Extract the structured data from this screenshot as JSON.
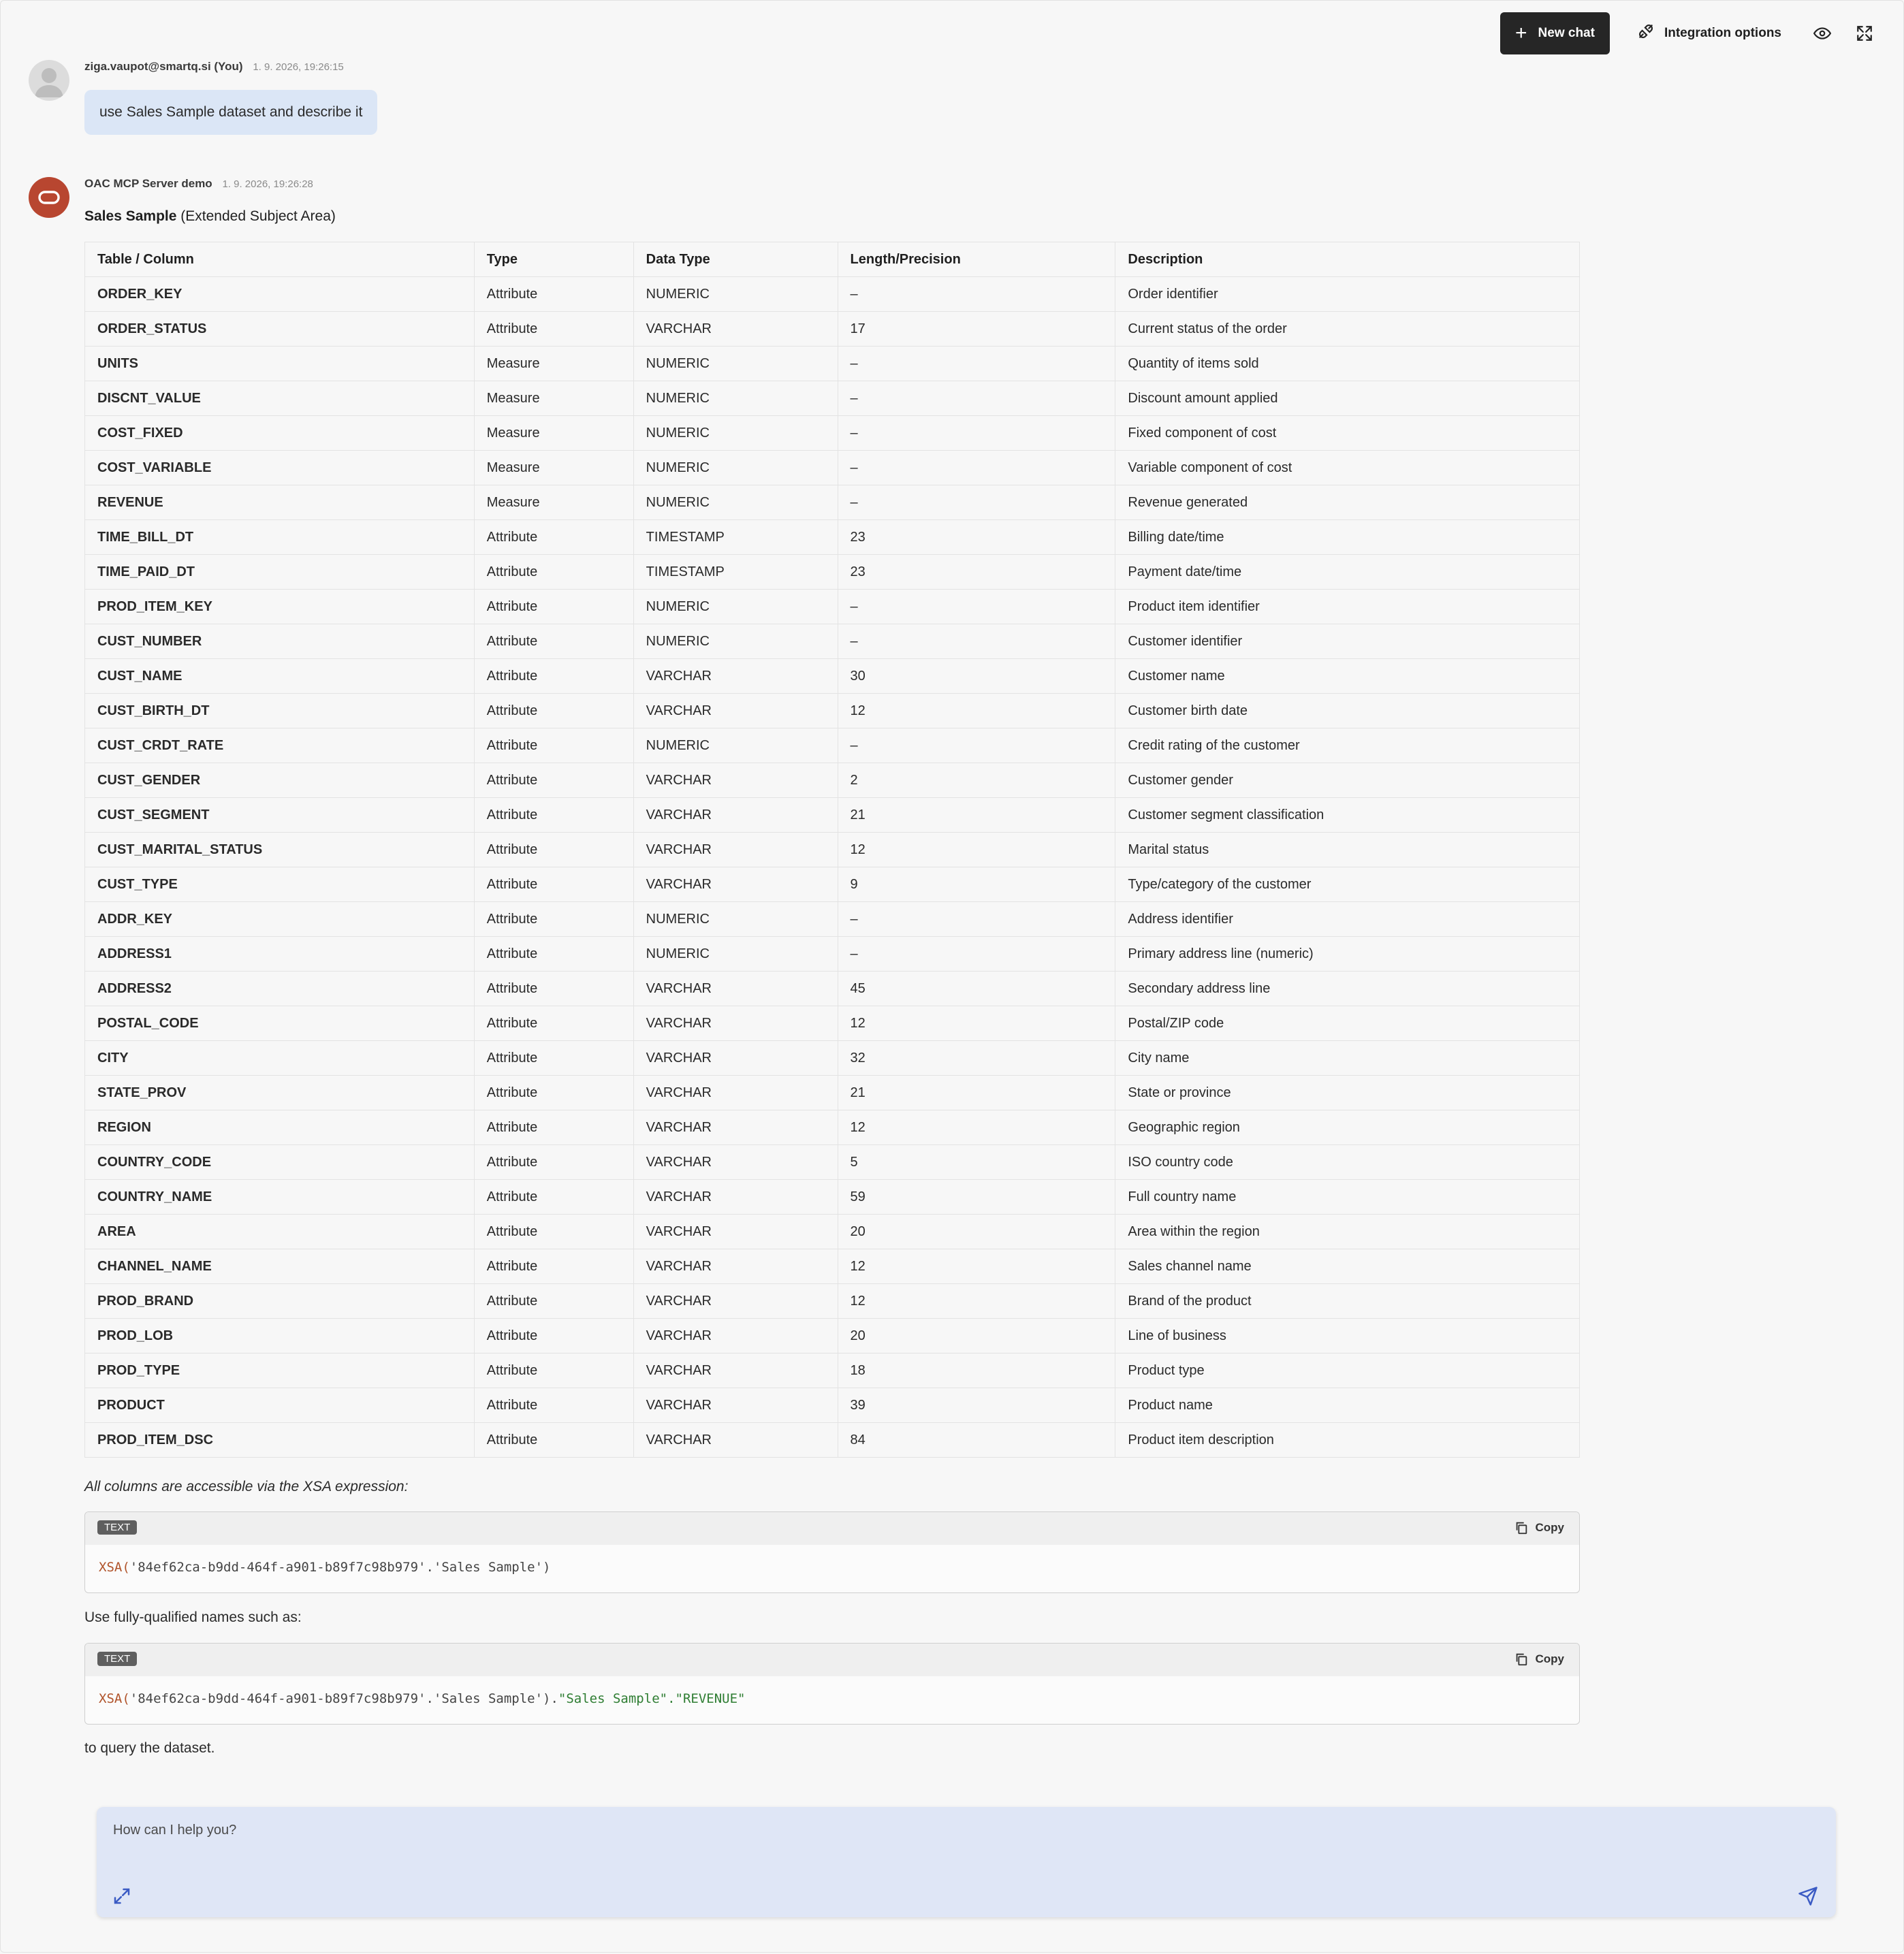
{
  "toolbar": {
    "new_chat_label": "New chat",
    "integration_label": "Integration options",
    "new_chat_icon": "plus-icon",
    "integration_icon": "plug-icon",
    "visibility_icon": "eye-icon",
    "fullscreen_icon": "fullscreen-icon"
  },
  "user_message": {
    "author": "ziga.vaupot@smartq.si (You)",
    "timestamp": "1. 9. 2026, 19:26:15",
    "text": "use Sales Sample dataset and describe it"
  },
  "bot_message": {
    "author": "OAC MCP Server demo",
    "timestamp": "1. 9. 2026, 19:26:28",
    "dataset_name": "Sales Sample",
    "dataset_suffix": "(Extended Subject Area)",
    "table": {
      "headers": [
        "Table / Column",
        "Type",
        "Data Type",
        "Length/Precision",
        "Description"
      ],
      "rows": [
        [
          "ORDER_KEY",
          "Attribute",
          "NUMERIC",
          "–",
          "Order identifier"
        ],
        [
          "ORDER_STATUS",
          "Attribute",
          "VARCHAR",
          "17",
          "Current status of the order"
        ],
        [
          "UNITS",
          "Measure",
          "NUMERIC",
          "–",
          "Quantity of items sold"
        ],
        [
          "DISCNT_VALUE",
          "Measure",
          "NUMERIC",
          "–",
          "Discount amount applied"
        ],
        [
          "COST_FIXED",
          "Measure",
          "NUMERIC",
          "–",
          "Fixed component of cost"
        ],
        [
          "COST_VARIABLE",
          "Measure",
          "NUMERIC",
          "–",
          "Variable component of cost"
        ],
        [
          "REVENUE",
          "Measure",
          "NUMERIC",
          "–",
          "Revenue generated"
        ],
        [
          "TIME_BILL_DT",
          "Attribute",
          "TIMESTAMP",
          "23",
          "Billing date/time"
        ],
        [
          "TIME_PAID_DT",
          "Attribute",
          "TIMESTAMP",
          "23",
          "Payment date/time"
        ],
        [
          "PROD_ITEM_KEY",
          "Attribute",
          "NUMERIC",
          "–",
          "Product item identifier"
        ],
        [
          "CUST_NUMBER",
          "Attribute",
          "NUMERIC",
          "–",
          "Customer identifier"
        ],
        [
          "CUST_NAME",
          "Attribute",
          "VARCHAR",
          "30",
          "Customer name"
        ],
        [
          "CUST_BIRTH_DT",
          "Attribute",
          "VARCHAR",
          "12",
          "Customer birth date"
        ],
        [
          "CUST_CRDT_RATE",
          "Attribute",
          "NUMERIC",
          "–",
          "Credit rating of the customer"
        ],
        [
          "CUST_GENDER",
          "Attribute",
          "VARCHAR",
          "2",
          "Customer gender"
        ],
        [
          "CUST_SEGMENT",
          "Attribute",
          "VARCHAR",
          "21",
          "Customer segment classification"
        ],
        [
          "CUST_MARITAL_STATUS",
          "Attribute",
          "VARCHAR",
          "12",
          "Marital status"
        ],
        [
          "CUST_TYPE",
          "Attribute",
          "VARCHAR",
          "9",
          "Type/category of the customer"
        ],
        [
          "ADDR_KEY",
          "Attribute",
          "NUMERIC",
          "–",
          "Address identifier"
        ],
        [
          "ADDRESS1",
          "Attribute",
          "NUMERIC",
          "–",
          "Primary address line (numeric)"
        ],
        [
          "ADDRESS2",
          "Attribute",
          "VARCHAR",
          "45",
          "Secondary address line"
        ],
        [
          "POSTAL_CODE",
          "Attribute",
          "VARCHAR",
          "12",
          "Postal/ZIP code"
        ],
        [
          "CITY",
          "Attribute",
          "VARCHAR",
          "32",
          "City name"
        ],
        [
          "STATE_PROV",
          "Attribute",
          "VARCHAR",
          "21",
          "State or province"
        ],
        [
          "REGION",
          "Attribute",
          "VARCHAR",
          "12",
          "Geographic region"
        ],
        [
          "COUNTRY_CODE",
          "Attribute",
          "VARCHAR",
          "5",
          "ISO country code"
        ],
        [
          "COUNTRY_NAME",
          "Attribute",
          "VARCHAR",
          "59",
          "Full country name"
        ],
        [
          "AREA",
          "Attribute",
          "VARCHAR",
          "20",
          "Area within the region"
        ],
        [
          "CHANNEL_NAME",
          "Attribute",
          "VARCHAR",
          "12",
          "Sales channel name"
        ],
        [
          "PROD_BRAND",
          "Attribute",
          "VARCHAR",
          "12",
          "Brand of the product"
        ],
        [
          "PROD_LOB",
          "Attribute",
          "VARCHAR",
          "20",
          "Line of business"
        ],
        [
          "PROD_TYPE",
          "Attribute",
          "VARCHAR",
          "18",
          "Product type"
        ],
        [
          "PRODUCT",
          "Attribute",
          "VARCHAR",
          "39",
          "Product name"
        ],
        [
          "PROD_ITEM_DSC",
          "Attribute",
          "VARCHAR",
          "84",
          "Product item description"
        ]
      ]
    },
    "xsa_intro": "All columns are accessible via the XSA expression:",
    "code1": {
      "badge": "TEXT",
      "copy_label": "Copy",
      "fn": "XSA(",
      "args": "'84ef62ca-b9dd-464f-a901-b89f7c98b979'.'Sales Sample')",
      "qualified": ""
    },
    "fq_intro": "Use fully-qualified names such as:",
    "code2": {
      "badge": "TEXT",
      "copy_label": "Copy",
      "fn": "XSA(",
      "args": "'84ef62ca-b9dd-464f-a901-b89f7c98b979'.'Sales Sample').",
      "qualified": "\"Sales Sample\".\"REVENUE\""
    },
    "outro": "to query the dataset."
  },
  "composer": {
    "placeholder": "How can I help you?",
    "expand_icon": "expand-icon",
    "send_icon": "send-icon"
  },
  "colors": {
    "accent_dark": "#262626",
    "bot_avatar": "#b84630",
    "user_bubble": "#dbe6f6",
    "composer_bg": "#dfe6f6",
    "send_icon": "#3b5bc4"
  }
}
